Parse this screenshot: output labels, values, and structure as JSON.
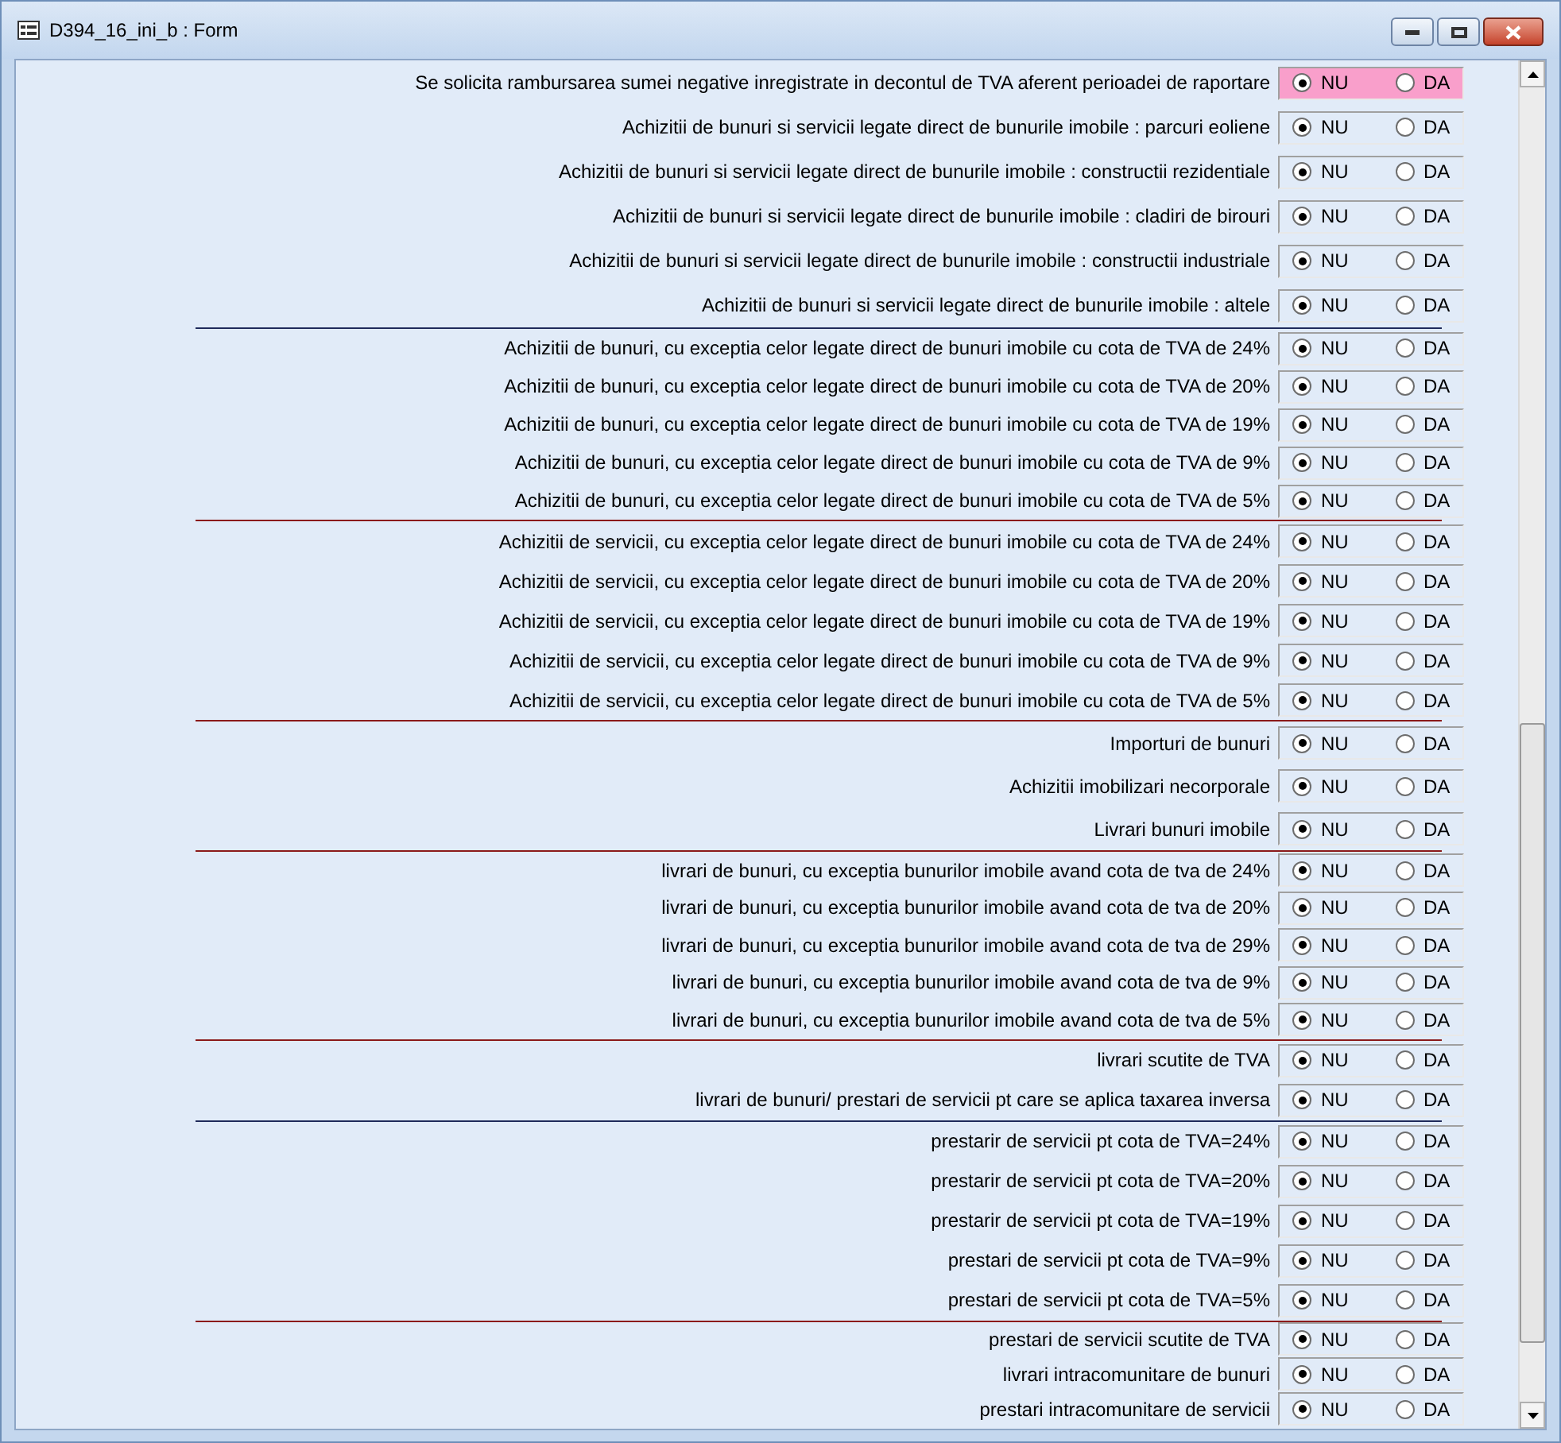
{
  "window": {
    "title": "D394_16_ini_b : Form"
  },
  "sections": [
    {
      "rows": [
        {
          "label": "Se solicita rambursarea sumei negative inregistrate in decontul de TVA aferent perioadei de raportare",
          "highlighted": true,
          "options": [
            {
              "label": "NU",
              "selected": true
            },
            {
              "label": "DA",
              "selected": false
            }
          ]
        },
        {
          "label": "Achizitii de bunuri si servicii legate direct de bunurile imobile : parcuri eoliene",
          "highlighted": false,
          "options": [
            {
              "label": "NU",
              "selected": true
            },
            {
              "label": "DA",
              "selected": false
            }
          ]
        },
        {
          "label": "Achizitii de bunuri si servicii legate direct de bunurile imobile : constructii rezidentiale",
          "highlighted": false,
          "options": [
            {
              "label": "NU",
              "selected": true
            },
            {
              "label": "DA",
              "selected": false
            }
          ]
        },
        {
          "label": "Achizitii de bunuri si servicii legate direct de bunurile imobile : cladiri de birouri",
          "highlighted": false,
          "options": [
            {
              "label": "NU",
              "selected": true
            },
            {
              "label": "DA",
              "selected": false
            }
          ]
        },
        {
          "label": "Achizitii de bunuri si servicii legate direct de bunurile imobile : constructii industriale",
          "highlighted": false,
          "options": [
            {
              "label": "NU",
              "selected": true
            },
            {
              "label": "DA",
              "selected": false
            }
          ]
        },
        {
          "label": "Achizitii de bunuri si servicii legate direct de bunurile imobile : altele",
          "highlighted": false,
          "options": [
            {
              "label": "NU",
              "selected": true
            },
            {
              "label": "DA",
              "selected": false
            }
          ]
        }
      ]
    },
    {
      "color": "#1f2a5a",
      "rows": [
        {
          "label": "Achizitii de bunuri, cu exceptia celor legate direct de bunuri imobile cu cota de TVA de 24%",
          "highlighted": false,
          "options": [
            {
              "label": "NU",
              "selected": true
            },
            {
              "label": "DA",
              "selected": false
            }
          ]
        },
        {
          "label": "Achizitii de bunuri, cu exceptia celor legate direct de bunuri imobile cu cota de TVA de 20%",
          "highlighted": false,
          "options": [
            {
              "label": "NU",
              "selected": true
            },
            {
              "label": "DA",
              "selected": false
            }
          ]
        },
        {
          "label": "Achizitii de bunuri, cu exceptia celor legate direct de bunuri imobile cu cota de TVA de 19%",
          "highlighted": false,
          "options": [
            {
              "label": "NU",
              "selected": true
            },
            {
              "label": "DA",
              "selected": false
            }
          ]
        },
        {
          "label": "Achizitii de bunuri, cu exceptia celor legate direct de bunuri imobile cu cota de TVA de 9%",
          "highlighted": false,
          "options": [
            {
              "label": "NU",
              "selected": true
            },
            {
              "label": "DA",
              "selected": false
            }
          ]
        },
        {
          "label": "Achizitii de bunuri, cu exceptia celor legate direct de bunuri imobile cu cota de TVA de 5%",
          "highlighted": false,
          "options": [
            {
              "label": "NU",
              "selected": true
            },
            {
              "label": "DA",
              "selected": false
            }
          ]
        }
      ]
    },
    {
      "color": "#8b1a1a",
      "rows": [
        {
          "label": "Achizitii de servicii, cu exceptia celor legate direct de bunuri imobile cu cota de TVA de 24%",
          "highlighted": false,
          "options": [
            {
              "label": "NU",
              "selected": true
            },
            {
              "label": "DA",
              "selected": false
            }
          ]
        },
        {
          "label": "Achizitii de servicii, cu exceptia celor legate direct de bunuri imobile cu cota de TVA de 20%",
          "highlighted": false,
          "options": [
            {
              "label": "NU",
              "selected": true
            },
            {
              "label": "DA",
              "selected": false
            }
          ]
        },
        {
          "label": "Achizitii de servicii, cu exceptia celor legate direct de bunuri imobile cu cota de TVA de 19%",
          "highlighted": false,
          "options": [
            {
              "label": "NU",
              "selected": true
            },
            {
              "label": "DA",
              "selected": false
            }
          ]
        },
        {
          "label": "Achizitii de servicii, cu exceptia celor legate direct de bunuri imobile cu cota de TVA de 9%",
          "highlighted": false,
          "options": [
            {
              "label": "NU",
              "selected": true
            },
            {
              "label": "DA",
              "selected": false
            }
          ]
        },
        {
          "label": "Achizitii de servicii, cu exceptia celor legate direct de bunuri imobile cu cota de TVA de 5%",
          "highlighted": false,
          "options": [
            {
              "label": "NU",
              "selected": true
            },
            {
              "label": "DA",
              "selected": false
            }
          ]
        }
      ]
    },
    {
      "color": "#8b1a1a",
      "rows": [
        {
          "label": "Importuri de bunuri",
          "highlighted": false,
          "options": [
            {
              "label": "NU",
              "selected": true
            },
            {
              "label": "DA",
              "selected": false
            }
          ]
        },
        {
          "label": "Achizitii imobilizari necorporale",
          "highlighted": false,
          "options": [
            {
              "label": "NU",
              "selected": true
            },
            {
              "label": "DA",
              "selected": false
            }
          ]
        },
        {
          "label": "Livrari bunuri imobile",
          "highlighted": false,
          "options": [
            {
              "label": "NU",
              "selected": true
            },
            {
              "label": "DA",
              "selected": false
            }
          ]
        }
      ]
    },
    {
      "color": "#8b1a1a",
      "rows": [
        {
          "label": "livrari de bunuri, cu exceptia bunurilor imobile avand cota de tva de 24%",
          "highlighted": false,
          "options": [
            {
              "label": "NU",
              "selected": true
            },
            {
              "label": "DA",
              "selected": false
            }
          ]
        },
        {
          "label": "livrari de bunuri, cu exceptia bunurilor imobile avand cota de tva de 20%",
          "highlighted": false,
          "options": [
            {
              "label": "NU",
              "selected": true
            },
            {
              "label": "DA",
              "selected": false
            }
          ]
        },
        {
          "label": "livrari de bunuri, cu exceptia bunurilor imobile avand cota de tva de 29%",
          "highlighted": false,
          "options": [
            {
              "label": "NU",
              "selected": true
            },
            {
              "label": "DA",
              "selected": false
            }
          ]
        },
        {
          "label": "livrari de bunuri, cu exceptia bunurilor imobile avand cota de tva de 9%",
          "highlighted": false,
          "options": [
            {
              "label": "NU",
              "selected": true
            },
            {
              "label": "DA",
              "selected": false
            }
          ]
        },
        {
          "label": "livrari de bunuri, cu exceptia bunurilor imobile avand cota de tva de 5%",
          "highlighted": false,
          "options": [
            {
              "label": "NU",
              "selected": true
            },
            {
              "label": "DA",
              "selected": false
            }
          ]
        }
      ]
    },
    {
      "color": "#8b1a1a",
      "rows": [
        {
          "label": "livrari scutite de TVA",
          "highlighted": false,
          "options": [
            {
              "label": "NU",
              "selected": true
            },
            {
              "label": "DA",
              "selected": false
            }
          ]
        },
        {
          "label": "livrari de bunuri/ prestari de servicii pt care se aplica taxarea inversa",
          "highlighted": false,
          "options": [
            {
              "label": "NU",
              "selected": true
            },
            {
              "label": "DA",
              "selected": false
            }
          ]
        }
      ]
    },
    {
      "color": "#1f2a5a",
      "rows": [
        {
          "label": "prestarir de servicii pt cota de TVA=24%",
          "highlighted": false,
          "options": [
            {
              "label": "NU",
              "selected": true
            },
            {
              "label": "DA",
              "selected": false
            }
          ]
        },
        {
          "label": "prestarir de servicii pt cota de TVA=20%",
          "highlighted": false,
          "options": [
            {
              "label": "NU",
              "selected": true
            },
            {
              "label": "DA",
              "selected": false
            }
          ]
        },
        {
          "label": "prestarir de servicii pt cota de TVA=19%",
          "highlighted": false,
          "options": [
            {
              "label": "NU",
              "selected": true
            },
            {
              "label": "DA",
              "selected": false
            }
          ]
        },
        {
          "label": "prestari de servicii pt cota de TVA=9%",
          "highlighted": false,
          "options": [
            {
              "label": "NU",
              "selected": true
            },
            {
              "label": "DA",
              "selected": false
            }
          ]
        },
        {
          "label": "prestari de servicii pt cota de TVA=5%",
          "highlighted": false,
          "options": [
            {
              "label": "NU",
              "selected": true
            },
            {
              "label": "DA",
              "selected": false
            }
          ]
        }
      ]
    },
    {
      "color": "#8b1a1a",
      "rows": [
        {
          "label": "prestari de servicii scutite de TVA",
          "highlighted": false,
          "options": [
            {
              "label": "NU",
              "selected": true
            },
            {
              "label": "DA",
              "selected": false
            }
          ]
        },
        {
          "label": "livrari intracomunitare de bunuri",
          "highlighted": false,
          "options": [
            {
              "label": "NU",
              "selected": true
            },
            {
              "label": "DA",
              "selected": false
            }
          ]
        },
        {
          "label": "prestari intracomunitare de servicii",
          "highlighted": false,
          "options": [
            {
              "label": "NU",
              "selected": true
            },
            {
              "label": "DA",
              "selected": false
            }
          ]
        }
      ]
    }
  ]
}
